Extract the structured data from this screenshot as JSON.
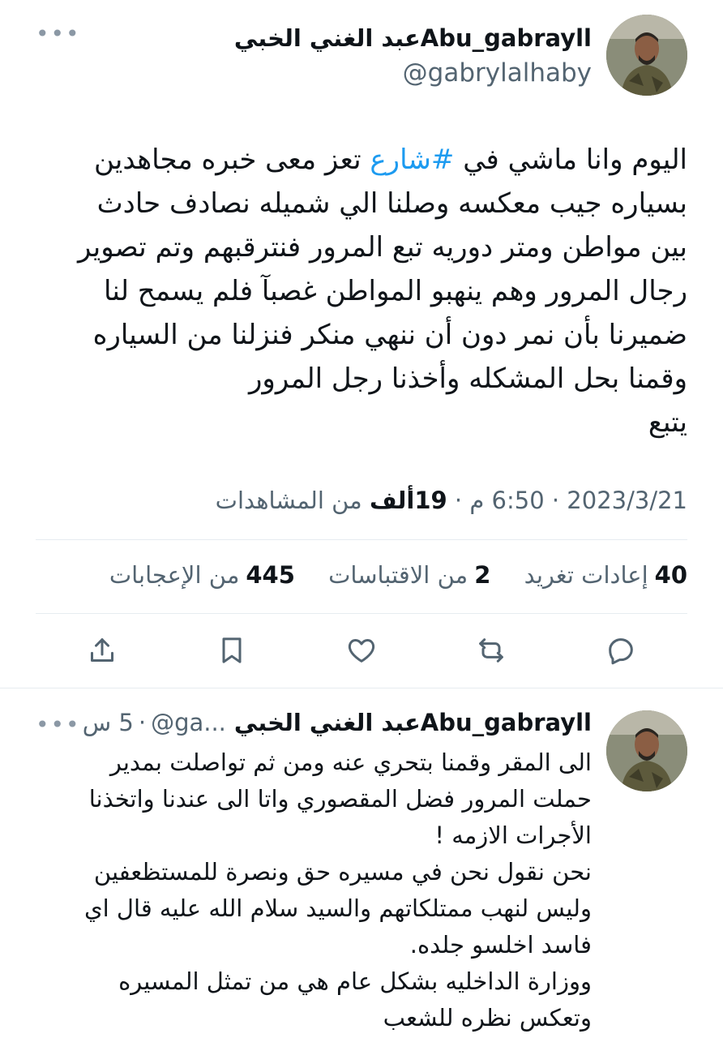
{
  "tweet": {
    "display_name": "عبد الغني الخبيAbu_gabrayll",
    "handle": "@gabrylalhaby",
    "avatar_icon": "profile-photo",
    "text_line1_before": "اليوم وانا ماشي في ",
    "hashtag": "#شارع",
    "text_line1_after": " تعز معى خبره مجاهدين",
    "text_rest": "بسياره جيب معكسه وصلنا الي شميله نصادف حادث\nبين مواطن ومتر دوريه تبع المرور فنترقبهم وتم تصوير\nرجال المرور وهم ينهبو المواطن غصبآ فلم يسمح لنا\nضميرنا بأن نمر دون أن ننهي منكر فنزلنا من السياره\nوقمنا بحل المشكله وأخذنا رجل المرور\nيتبع",
    "date": "2023/3/21",
    "time": "6:50 م",
    "views_count": "19",
    "views_unit": "ألف",
    "views_label": "من المشاهدات",
    "retweets_count": "40",
    "retweets_label": "إعادات تغريد",
    "quotes_count": "2",
    "quotes_label": "من الاقتباسات",
    "likes_count": "445",
    "likes_label": "من الإعجابات",
    "actions": [
      "reply-icon",
      "retweet-icon",
      "like-icon",
      "bookmark-icon",
      "share-icon"
    ]
  },
  "reply": {
    "display_name": "عبد الغني الخبيAbu_gabrayll",
    "handle_truncated": "@ga...",
    "age": "5 س",
    "text": "الى المقر وقمنا بتحري عنه ومن ثم تواصلت بمدير\nحملت المرور فضل المقصوري واتا الى عندنا واتخذنا\nالأجرات الازمه !\nنحن نقول نحن في مسيره حق ونصرة للمستظعفين\nوليس لنهب ممتلكاتهم والسيد سلام الله عليه قال اي\nفاسد اخلسو جلده.\nووزارة الداخليه بشكل عام هي من تمثل المسيره\nوتعكس نظره للشعب"
  },
  "colors": {
    "text": "#0f1419",
    "secondary": "#536471",
    "accent": "#1d9bf0",
    "divider": "#e6ecf0"
  }
}
